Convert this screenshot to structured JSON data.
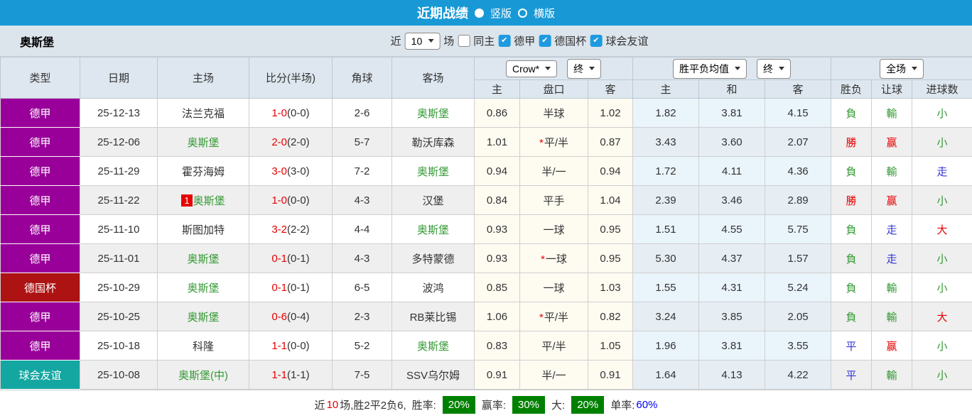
{
  "titlebar": {
    "title": "近期战绩",
    "options": [
      {
        "label": "竖版",
        "selected": true
      },
      {
        "label": "横版",
        "selected": false
      }
    ]
  },
  "filterbar": {
    "team": "奥斯堡",
    "near_label": "近",
    "count_value": "10",
    "matches_label": "场",
    "checkboxes": [
      {
        "label": "同主",
        "checked": false
      },
      {
        "label": "德甲",
        "checked": true
      },
      {
        "label": "德国杯",
        "checked": true
      },
      {
        "label": "球会友谊",
        "checked": true
      }
    ]
  },
  "table": {
    "star": "*",
    "columns": {
      "type": "类型",
      "date": "日期",
      "home": "主场",
      "score": "比分(半场)",
      "corner": "角球",
      "away": "客场"
    },
    "group_odds": {
      "select_company": "Crow*",
      "select_time": "终",
      "subcols": [
        "主",
        "盘口",
        "客"
      ]
    },
    "group_avg": {
      "select_name": "胜平负均值",
      "select_time": "终",
      "subcols": [
        "主",
        "和",
        "客"
      ]
    },
    "group_result": {
      "select_name": "全场",
      "subcols": [
        "胜负",
        "让球",
        "进球数"
      ]
    },
    "rows": [
      {
        "type": "德甲",
        "type_color": "#990099",
        "date": "25-12-13",
        "home": "法兰克福",
        "home_green": false,
        "home_badge": "",
        "score": "1-0",
        "half": "(0-0)",
        "corner": "2-6",
        "away": "奥斯堡",
        "away_green": true,
        "odds_home": "0.86",
        "handicap": "半球",
        "handicap_star": false,
        "odds_away": "1.02",
        "avg_home": "1.82",
        "avg_draw": "3.81",
        "avg_away": "4.15",
        "result": "負",
        "result_color": "green",
        "let_result": "輸",
        "let_color": "green",
        "goal_result": "小",
        "goal_color": "green"
      },
      {
        "type": "德甲",
        "type_color": "#990099",
        "date": "25-12-06",
        "home": "奥斯堡",
        "home_green": true,
        "home_badge": "",
        "score": "2-0",
        "half": "(2-0)",
        "corner": "5-7",
        "away": "勒沃库森",
        "away_green": false,
        "odds_home": "1.01",
        "handicap": "平/半",
        "handicap_star": true,
        "odds_away": "0.87",
        "avg_home": "3.43",
        "avg_draw": "3.60",
        "avg_away": "2.07",
        "result": "勝",
        "result_color": "red",
        "let_result": "赢",
        "let_color": "red",
        "goal_result": "小",
        "goal_color": "green"
      },
      {
        "type": "德甲",
        "type_color": "#990099",
        "date": "25-11-29",
        "home": "霍芬海姆",
        "home_green": false,
        "home_badge": "",
        "score": "3-0",
        "half": "(3-0)",
        "corner": "7-2",
        "away": "奥斯堡",
        "away_green": true,
        "odds_home": "0.94",
        "handicap": "半/一",
        "handicap_star": false,
        "odds_away": "0.94",
        "avg_home": "1.72",
        "avg_draw": "4.11",
        "avg_away": "4.36",
        "result": "負",
        "result_color": "green",
        "let_result": "輸",
        "let_color": "green",
        "goal_result": "走",
        "goal_color": "blue"
      },
      {
        "type": "德甲",
        "type_color": "#990099",
        "date": "25-11-22",
        "home": "奥斯堡",
        "home_green": true,
        "home_badge": "1",
        "score": "1-0",
        "half": "(0-0)",
        "corner": "4-3",
        "away": "汉堡",
        "away_green": false,
        "odds_home": "0.84",
        "handicap": "平手",
        "handicap_star": false,
        "odds_away": "1.04",
        "avg_home": "2.39",
        "avg_draw": "3.46",
        "avg_away": "2.89",
        "result": "勝",
        "result_color": "red",
        "let_result": "赢",
        "let_color": "red",
        "goal_result": "小",
        "goal_color": "green"
      },
      {
        "type": "德甲",
        "type_color": "#990099",
        "date": "25-11-10",
        "home": "斯图加特",
        "home_green": false,
        "home_badge": "",
        "score": "3-2",
        "half": "(2-2)",
        "corner": "4-4",
        "away": "奥斯堡",
        "away_green": true,
        "odds_home": "0.93",
        "handicap": "一球",
        "handicap_star": false,
        "odds_away": "0.95",
        "avg_home": "1.51",
        "avg_draw": "4.55",
        "avg_away": "5.75",
        "result": "負",
        "result_color": "green",
        "let_result": "走",
        "let_color": "blue",
        "goal_result": "大",
        "goal_color": "red"
      },
      {
        "type": "德甲",
        "type_color": "#990099",
        "date": "25-11-01",
        "home": "奥斯堡",
        "home_green": true,
        "home_badge": "",
        "score": "0-1",
        "half": "(0-1)",
        "corner": "4-3",
        "away": "多特蒙德",
        "away_green": false,
        "odds_home": "0.93",
        "handicap": "一球",
        "handicap_star": true,
        "odds_away": "0.95",
        "avg_home": "5.30",
        "avg_draw": "4.37",
        "avg_away": "1.57",
        "result": "負",
        "result_color": "green",
        "let_result": "走",
        "let_color": "blue",
        "goal_result": "小",
        "goal_color": "green"
      },
      {
        "type": "德国杯",
        "type_color": "#AD1313",
        "date": "25-10-29",
        "home": "奥斯堡",
        "home_green": true,
        "home_badge": "",
        "score": "0-1",
        "half": "(0-1)",
        "corner": "6-5",
        "away": "波鸿",
        "away_green": false,
        "odds_home": "0.85",
        "handicap": "一球",
        "handicap_star": false,
        "odds_away": "1.03",
        "avg_home": "1.55",
        "avg_draw": "4.31",
        "avg_away": "5.24",
        "result": "負",
        "result_color": "green",
        "let_result": "輸",
        "let_color": "green",
        "goal_result": "小",
        "goal_color": "green"
      },
      {
        "type": "德甲",
        "type_color": "#990099",
        "date": "25-10-25",
        "home": "奥斯堡",
        "home_green": true,
        "home_badge": "",
        "score": "0-6",
        "half": "(0-4)",
        "corner": "2-3",
        "away": "RB莱比锡",
        "away_green": false,
        "odds_home": "1.06",
        "handicap": "平/半",
        "handicap_star": true,
        "odds_away": "0.82",
        "avg_home": "3.24",
        "avg_draw": "3.85",
        "avg_away": "2.05",
        "result": "負",
        "result_color": "green",
        "let_result": "輸",
        "let_color": "green",
        "goal_result": "大",
        "goal_color": "red"
      },
      {
        "type": "德甲",
        "type_color": "#990099",
        "date": "25-10-18",
        "home": "科隆",
        "home_green": false,
        "home_badge": "",
        "score": "1-1",
        "half": "(0-0)",
        "corner": "5-2",
        "away": "奥斯堡",
        "away_green": true,
        "odds_home": "0.83",
        "handicap": "平/半",
        "handicap_star": false,
        "odds_away": "1.05",
        "avg_home": "1.96",
        "avg_draw": "3.81",
        "avg_away": "3.55",
        "result": "平",
        "result_color": "blue",
        "let_result": "赢",
        "let_color": "red",
        "goal_result": "小",
        "goal_color": "green"
      },
      {
        "type": "球会友谊",
        "type_color": "#14A6A0",
        "date": "25-10-08",
        "home": "奥斯堡(中)",
        "home_green": true,
        "home_badge": "",
        "score": "1-1",
        "half": "(1-1)",
        "corner": "7-5",
        "away": "SSV乌尔姆",
        "away_green": false,
        "odds_home": "0.91",
        "handicap": "半/一",
        "handicap_star": false,
        "odds_away": "0.91",
        "avg_home": "1.64",
        "avg_draw": "4.13",
        "avg_away": "4.22",
        "result": "平",
        "result_color": "blue",
        "let_result": "輸",
        "let_color": "green",
        "goal_result": "小",
        "goal_color": "green"
      }
    ]
  },
  "footer": {
    "near": "近",
    "games": "10",
    "summary": "场,胜2平2负6,",
    "win_rate_label": "胜率:",
    "win_rate": "20%",
    "handicap_rate_label": "赢率:",
    "handicap_rate": "30%",
    "big_rate_label": "大:",
    "big_rate": "20%",
    "single_rate_label": "单率:",
    "single_rate": "60%"
  },
  "colors": {
    "titlebar_blue": "#1899D6",
    "filterbar_gray": "#DCE4EC",
    "header_gray": "#DEE7EF",
    "badge_league": "#990099",
    "badge_cup": "#AD1313",
    "badge_friendly": "#14A6A0",
    "team_green": "#339933",
    "loss_green": "#339933",
    "win_red": "#E60000",
    "draw_blue": "#3535D6",
    "pct_badge_green": "#008000",
    "single_rate_blue": "#0000EE",
    "odds_bg": "#FEFBF1",
    "avg_bg": "#EAF4FB"
  }
}
